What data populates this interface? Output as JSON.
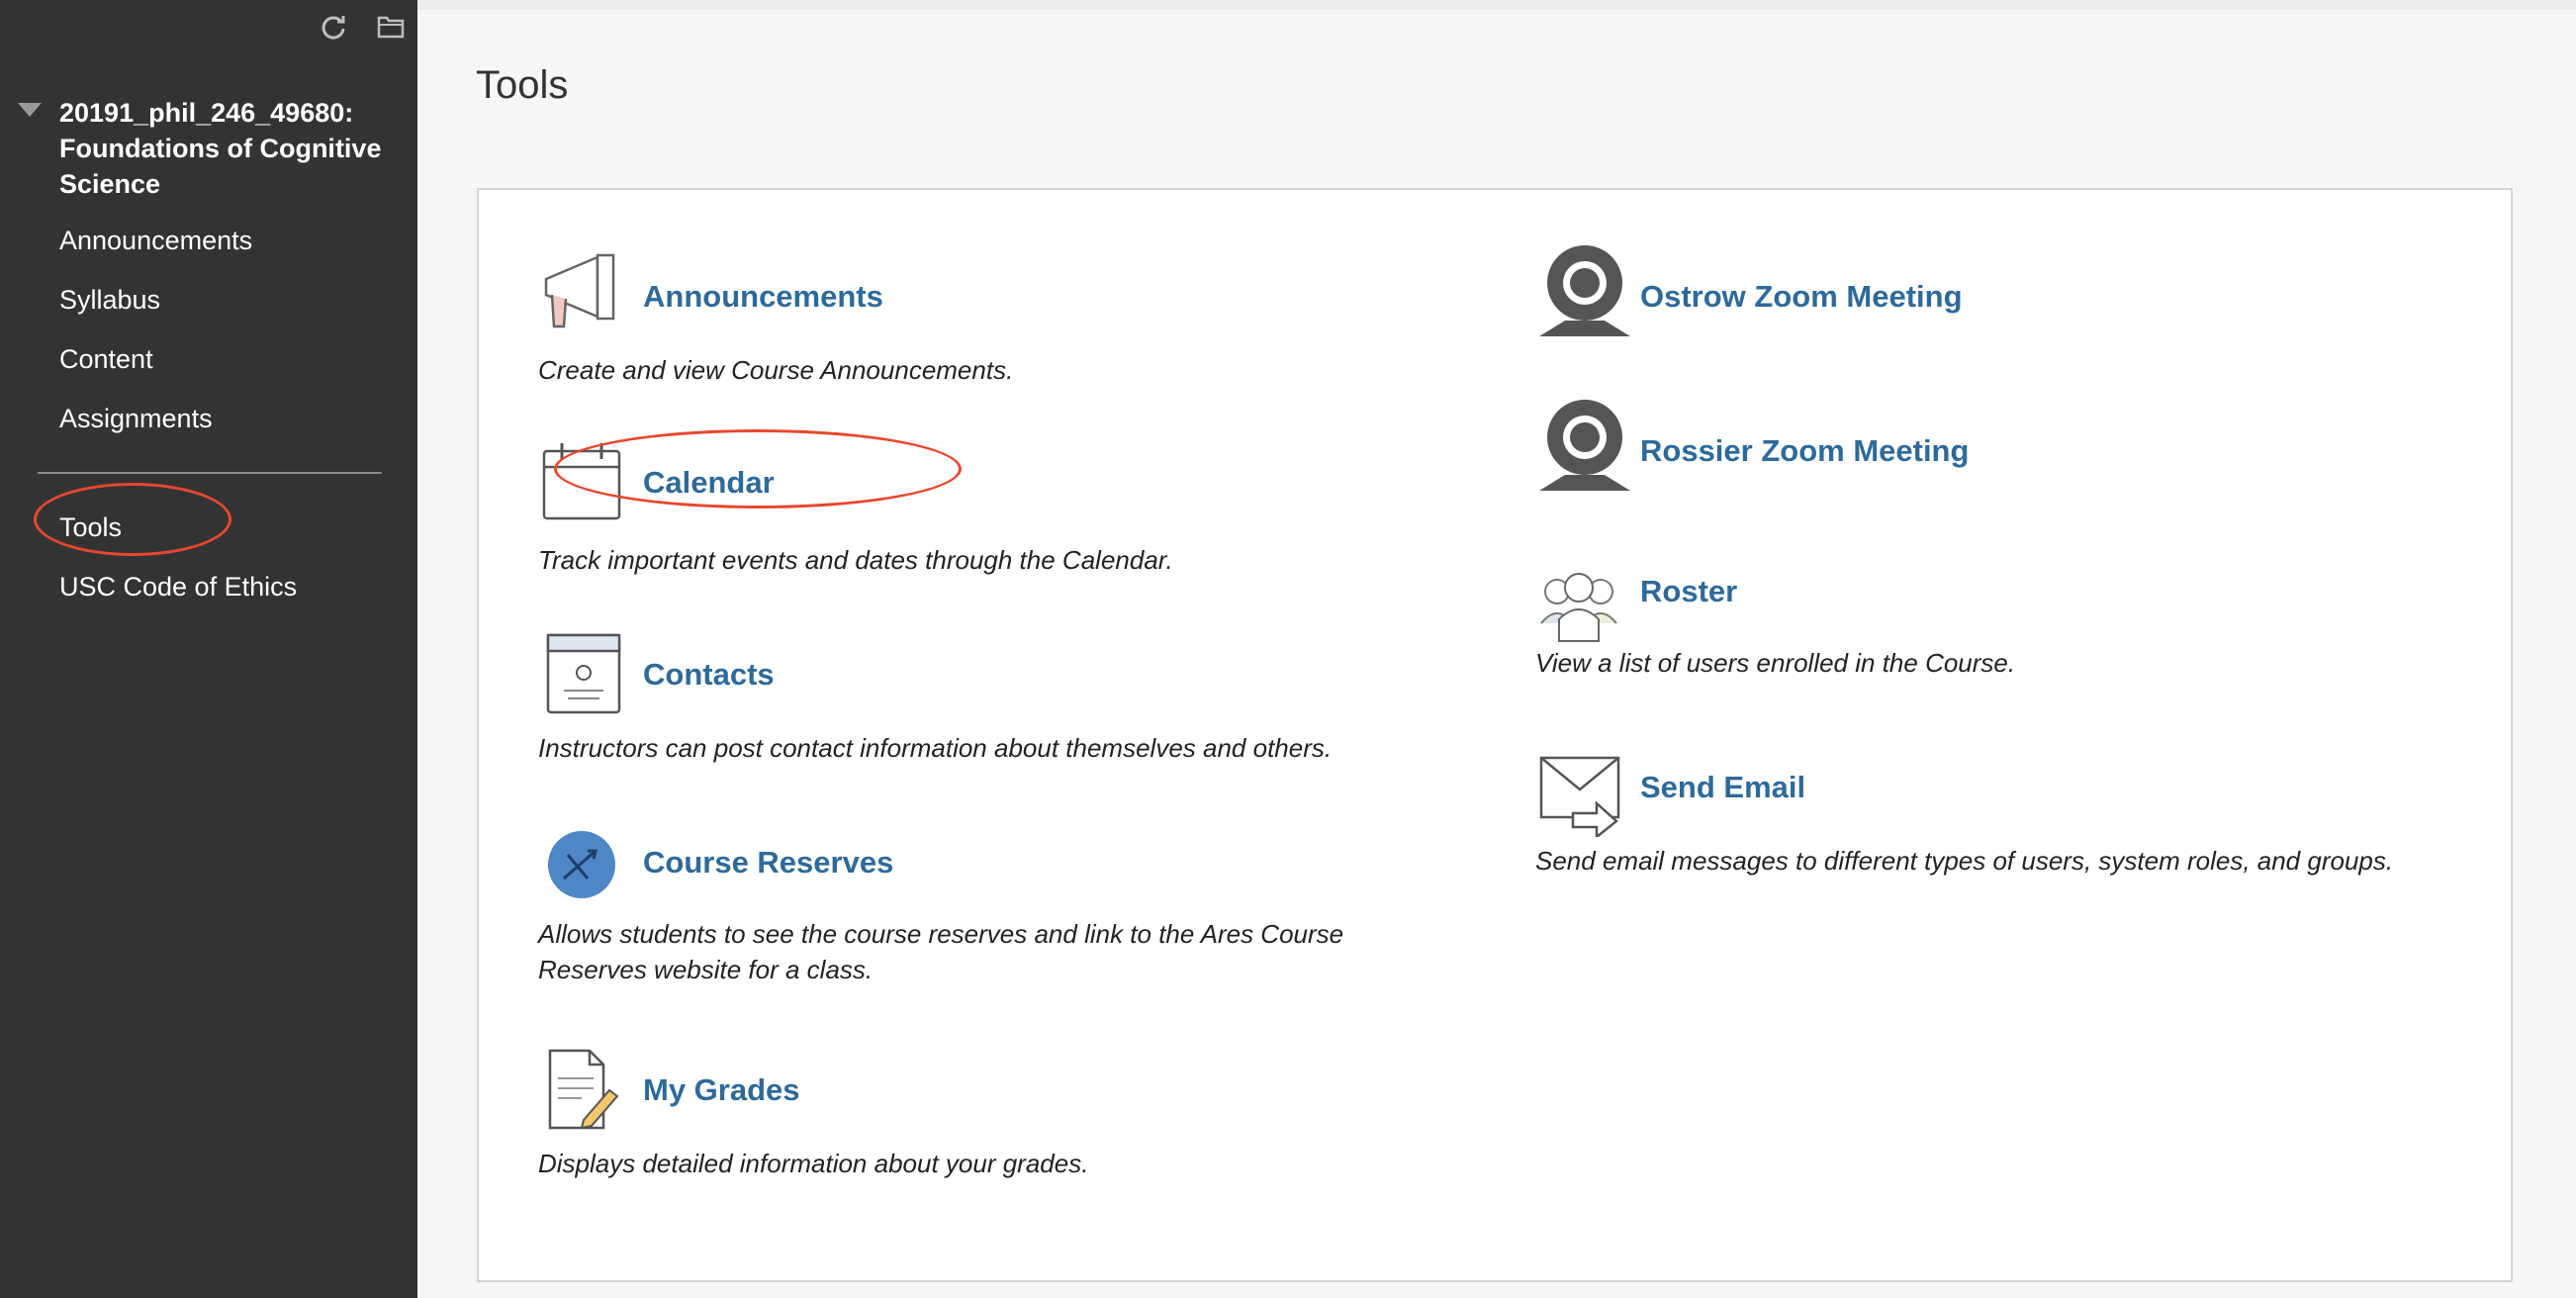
{
  "sidebar": {
    "course_title": "20191_phil_246_49680: Foundations of Cognitive Science",
    "items": [
      {
        "label": "Announcements"
      },
      {
        "label": "Syllabus"
      },
      {
        "label": "Content"
      },
      {
        "label": "Assignments"
      }
    ],
    "tools_label": "Tools",
    "ethics_label": "USC Code of Ethics"
  },
  "page": {
    "title": "Tools"
  },
  "tools": [
    {
      "name": "Announcements",
      "description": "Create and view Course Announcements.",
      "icon": "megaphone-icon"
    },
    {
      "name": "Calendar",
      "description": "Track important events and dates through the Calendar.",
      "icon": "calendar-icon"
    },
    {
      "name": "Contacts",
      "description": "Instructors can post contact information about themselves and others.",
      "icon": "contact-card-icon"
    },
    {
      "name": "Course Reserves",
      "description": "Allows students to see the course reserves and link to the Ares Course Reserves website for a class.",
      "icon": "course-reserves-icon"
    },
    {
      "name": "My Grades",
      "description": "Displays detailed information about your grades.",
      "icon": "grades-document-icon"
    },
    {
      "name": "Ostrow Zoom Meeting",
      "description": "",
      "icon": "webcam-icon"
    },
    {
      "name": "Rossier Zoom Meeting",
      "description": "",
      "icon": "webcam-icon"
    },
    {
      "name": "Roster",
      "description": "View a list of users enrolled in the Course.",
      "icon": "users-group-icon"
    },
    {
      "name": "Send Email",
      "description": "Send email messages to different types of users, system roles, and groups.",
      "icon": "envelope-send-icon"
    }
  ],
  "colors": {
    "sidebar_bg": "#333333",
    "link": "#2e6a99",
    "annotation": "#e8472f"
  }
}
